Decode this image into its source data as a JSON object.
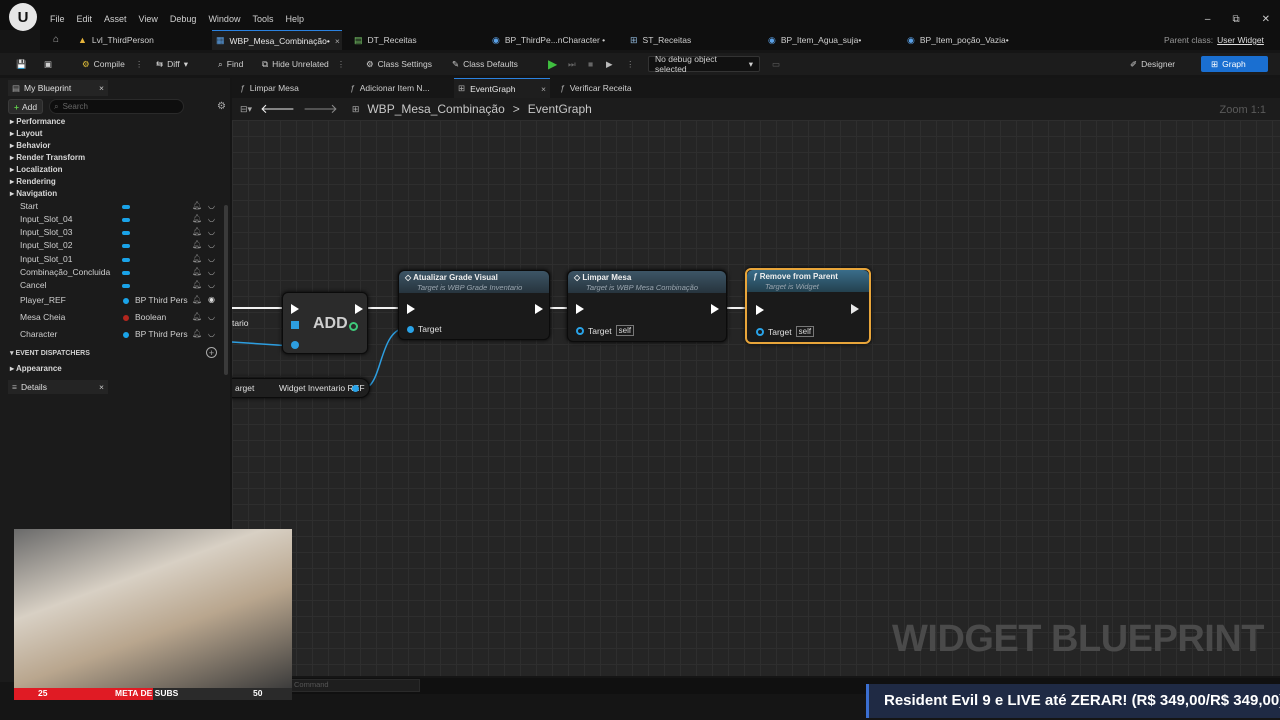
{
  "menubar": {
    "logo": "U",
    "items": [
      "File",
      "Edit",
      "Asset",
      "View",
      "Debug",
      "Window",
      "Tools",
      "Help"
    ],
    "window_controls": [
      "–",
      "⧉",
      "✕"
    ]
  },
  "tabs": [
    {
      "label": "Lvl_ThirdPerson",
      "icon": "level-icon"
    },
    {
      "label": "WBP_Mesa_Combinação•",
      "icon": "widget-icon",
      "active": true
    },
    {
      "label": "DT_Receitas",
      "icon": "datatable-icon"
    },
    {
      "label": "BP_ThirdPe...nCharacter •",
      "icon": "blueprint-icon"
    },
    {
      "label": "ST_Receitas",
      "icon": "struct-icon"
    },
    {
      "label": "BP_Item_Agua_suja•",
      "icon": "blueprint-icon"
    },
    {
      "label": "BP_Item_poção_Vazia•",
      "icon": "blueprint-icon"
    }
  ],
  "parent_class": {
    "label": "Parent class:",
    "value": "User Widget"
  },
  "toolbar": {
    "compile": "Compile",
    "diff": "Diff",
    "find": "Find",
    "hide_unrelated": "Hide Unrelated",
    "class_settings": "Class Settings",
    "class_defaults": "Class Defaults",
    "debug_object": "No debug object selected",
    "designer": "Designer",
    "graph": "Graph"
  },
  "left_panel": {
    "tab": "My Blueprint",
    "add": "Add",
    "search_placeholder": "Search",
    "categories": [
      "Performance",
      "Layout",
      "Behavior",
      "Render Transform",
      "Localization",
      "Rendering",
      "Navigation"
    ],
    "variables": [
      {
        "name": "Start",
        "type": ""
      },
      {
        "name": "Input_Slot_04",
        "type": ""
      },
      {
        "name": "Input_Slot_03",
        "type": ""
      },
      {
        "name": "Input_Slot_02",
        "type": ""
      },
      {
        "name": "Input_Slot_01",
        "type": ""
      },
      {
        "name": "Combinação_Concluida",
        "type": ""
      },
      {
        "name": "Cancel",
        "type": ""
      },
      {
        "name": "Player_REF",
        "type": "BP Third Pers"
      },
      {
        "name": "Mesa Cheia",
        "type": "Boolean"
      },
      {
        "name": "Character",
        "type": "BP Third Pers"
      }
    ],
    "event_dispatchers": "EVENT DISPATCHERS",
    "appearance": "Appearance",
    "details_tab": "Details"
  },
  "graph_tabs": [
    {
      "label": "Limpar Mesa"
    },
    {
      "label": "Adicionar Item N..."
    },
    {
      "label": "EventGraph",
      "active": true
    },
    {
      "label": "Verificar Receita"
    }
  ],
  "breadcrumb": {
    "root": "WBP_Mesa_Combinação",
    "sep": ">",
    "current": "EventGraph"
  },
  "zoom": "Zoom 1:1",
  "watermark": "WIDGET BLUEPRINT",
  "nodes": {
    "add": {
      "label": "ADD",
      "pin_left": "tario"
    },
    "atualizar": {
      "title": "Atualizar Grade Visual",
      "subtitle": "Target is WBP Grade Inventario",
      "pin": "Target"
    },
    "limpar": {
      "title": "Limpar Mesa",
      "subtitle": "Target is WBP Mesa Combinação",
      "pin": "Target",
      "self": "self"
    },
    "remove": {
      "title": "Remove from Parent",
      "subtitle": "Target is Widget",
      "pin": "Target",
      "self": "self"
    },
    "widget_ref": {
      "pin_left": "arget",
      "label": "Widget Inventario REF"
    }
  },
  "command_placeholder": "Command",
  "subs": {
    "left": "25",
    "title": "META DE SUBS",
    "right": "50",
    "progress": 0.5
  },
  "banner": "Resident Evil 9 e LIVE até ZERAR! (R$ 349,00/R$ 349,00)"
}
